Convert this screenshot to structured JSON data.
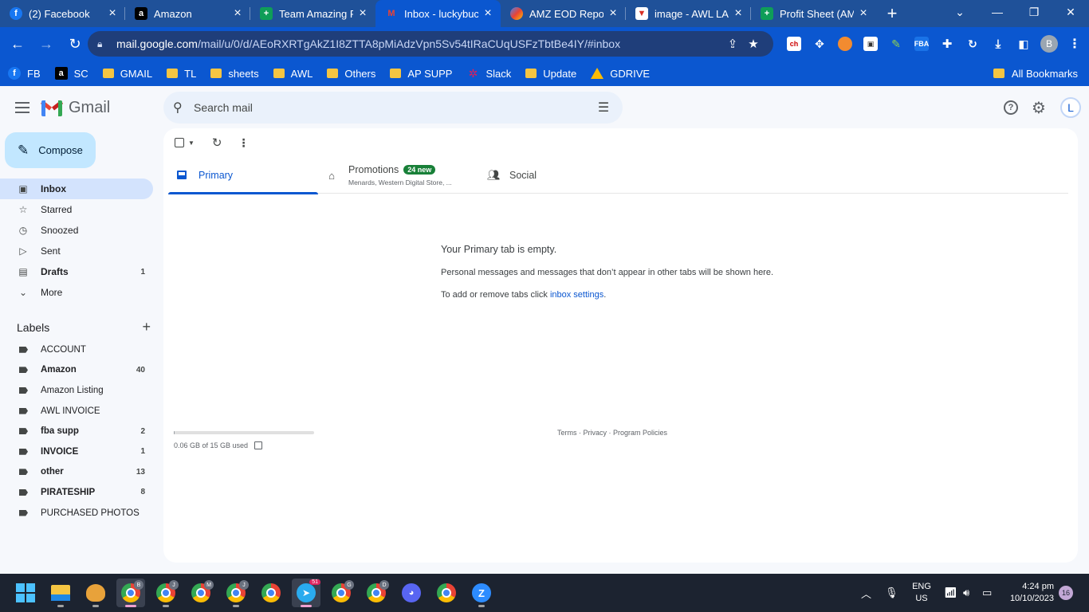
{
  "browser": {
    "tabs": [
      {
        "title": "(2) Facebook",
        "icon": "facebook-icon"
      },
      {
        "title": "Amazon",
        "icon": "amazon-icon"
      },
      {
        "title": "Team Amazing P",
        "icon": "sheets-icon"
      },
      {
        "title": "Inbox - luckybuc",
        "icon": "gmail-icon",
        "active": true
      },
      {
        "title": "AMZ EOD Repor",
        "icon": "amz-eod-icon"
      },
      {
        "title": "image - AWL LA",
        "icon": "image-icon"
      },
      {
        "title": "Profit Sheet (AM",
        "icon": "sheets-icon"
      }
    ],
    "url_host": "mail.google.com",
    "url_path": "/mail/u/0/d/AEoRXRTgAkZ1I8ZTTA8pMiAdzVpn5Sv54tIRaCUqUSFzTbtBe4IY/#inbox",
    "profile_initial": "B",
    "bookmarks": [
      {
        "label": "FB",
        "icon": "facebook-icon"
      },
      {
        "label": "SC",
        "icon": "amazon-icon"
      },
      {
        "label": "GMAIL",
        "icon": "folder-icon"
      },
      {
        "label": "TL",
        "icon": "folder-icon"
      },
      {
        "label": "sheets",
        "icon": "folder-icon"
      },
      {
        "label": "AWL",
        "icon": "folder-icon"
      },
      {
        "label": "Others",
        "icon": "folder-icon"
      },
      {
        "label": "AP SUPP",
        "icon": "folder-icon"
      },
      {
        "label": "Slack",
        "icon": "slack-icon"
      },
      {
        "label": "Update",
        "icon": "folder-icon"
      },
      {
        "label": "GDRIVE",
        "icon": "drive-icon"
      }
    ],
    "all_bookmarks": "All Bookmarks"
  },
  "gmail": {
    "logo_text": "Gmail",
    "search_placeholder": "Search mail",
    "account_initial": "L",
    "compose": "Compose",
    "nav": [
      {
        "label": "Inbox",
        "icon": "inbox-icon",
        "count": "",
        "active": true
      },
      {
        "label": "Starred",
        "icon": "star-icon",
        "count": ""
      },
      {
        "label": "Snoozed",
        "icon": "clock-icon",
        "count": ""
      },
      {
        "label": "Sent",
        "icon": "send-icon",
        "count": ""
      },
      {
        "label": "Drafts",
        "icon": "draft-icon",
        "count": "1",
        "bold": true
      },
      {
        "label": "More",
        "icon": "chevron-down-icon",
        "count": ""
      }
    ],
    "labels_title": "Labels",
    "labels": [
      {
        "label": "ACCOUNT",
        "count": "",
        "bold": false
      },
      {
        "label": "Amazon",
        "count": "40",
        "bold": true
      },
      {
        "label": "Amazon Listing",
        "count": "",
        "bold": false
      },
      {
        "label": "AWL INVOICE",
        "count": "",
        "bold": false
      },
      {
        "label": "fba supp",
        "count": "2",
        "bold": true
      },
      {
        "label": "INVOICE",
        "count": "1",
        "bold": true
      },
      {
        "label": "other",
        "count": "13",
        "bold": true
      },
      {
        "label": "PIRATESHIP",
        "count": "8",
        "bold": true
      },
      {
        "label": "PURCHASED PHOTOS",
        "count": "",
        "bold": false
      }
    ],
    "inbox_tabs": {
      "primary": "Primary",
      "promotions": "Promotions",
      "promotions_badge": "24 new",
      "promotions_sub": "Menards, Western Digital Store, ...",
      "social": "Social"
    },
    "empty": {
      "title": "Your Primary tab is empty.",
      "body": "Personal messages and messages that don’t appear in other tabs will be shown here.",
      "settings_prefix": "To add or remove tabs click ",
      "settings_link": "inbox settings",
      "settings_suffix": "."
    },
    "storage": {
      "text": "0.06 GB of 15 GB used",
      "fraction": 0.004
    },
    "footer": {
      "terms": "Terms",
      "sep": " · ",
      "privacy": "Privacy",
      "policies": "Program Policies"
    }
  },
  "taskbar": {
    "lang": "ENG",
    "region": "US",
    "time": "4:24 pm",
    "date": "10/10/2023",
    "notifications": "16",
    "telegram_badge": "51",
    "profile_badges": [
      "B",
      "J",
      "M",
      "J",
      "G",
      "D"
    ]
  },
  "colors": {
    "chrome_frame": "#1f5199",
    "chrome_toolbar": "#0b57d0",
    "gmail_accent": "#0b57d0",
    "compose_bg": "#c2e7ff",
    "badge_green": "#188038"
  }
}
